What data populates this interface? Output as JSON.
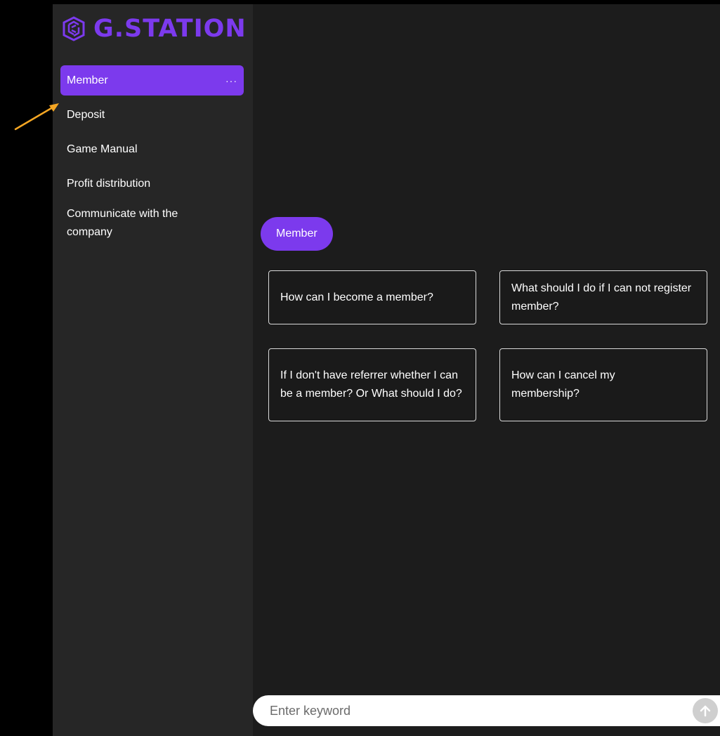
{
  "brand": {
    "name": "G.STATION",
    "color": "#7c3aed",
    "icon": "g-station-logo-icon"
  },
  "sidebar": {
    "items": [
      {
        "label": "Member",
        "active": true,
        "more_icon": "more-dots-icon"
      },
      {
        "label": "Deposit"
      },
      {
        "label": "Game Manual"
      },
      {
        "label": "Profit distribution"
      },
      {
        "label": "Communicate with the company"
      }
    ],
    "more_label": "···"
  },
  "annotation": {
    "icon": "arrow-pointer-icon",
    "color": "#f5a623"
  },
  "main": {
    "category": "Member",
    "questions": [
      {
        "text": "How can I become a member?"
      },
      {
        "text": "What should I do if I can not register member?"
      },
      {
        "text": "If I don't have referrer whether I can be a member? Or What should I do?"
      },
      {
        "text": "How can I cancel my membership?"
      }
    ]
  },
  "search": {
    "placeholder": "Enter keyword",
    "send_icon": "arrow-up-icon"
  },
  "colors": {
    "accent": "#7c3aed",
    "sidebar_bg": "#262626",
    "main_bg": "#1c1c1c"
  }
}
